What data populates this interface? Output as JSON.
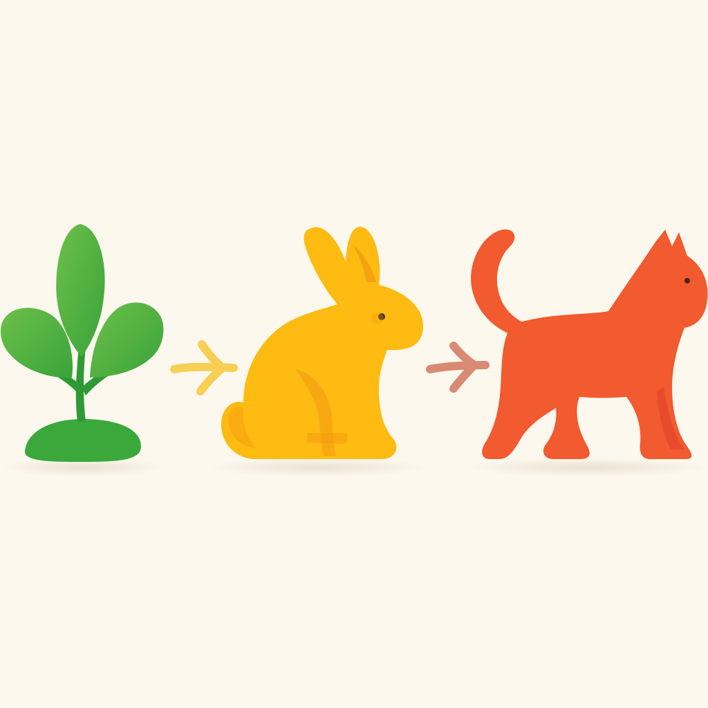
{
  "diagram": {
    "kind": "food-chain",
    "background_color": "#fdf8ee",
    "nodes": [
      {
        "id": "plant",
        "role": "producer",
        "icon": "sprout-icon",
        "color": "#4caf3a",
        "base_color": "#3aa83a"
      },
      {
        "id": "rabbit",
        "role": "herbivore",
        "icon": "rabbit-icon",
        "color": "#ffbb12",
        "shade_color": "#f39a10"
      },
      {
        "id": "cat",
        "role": "predator",
        "icon": "cat-icon",
        "color": "#f25a2f",
        "shade_color": "#e4452a"
      }
    ],
    "arrows": [
      {
        "from": "plant",
        "to": "rabbit",
        "icon": "arrow-right-icon",
        "color": "#f8cf55"
      },
      {
        "from": "rabbit",
        "to": "cat",
        "icon": "arrow-right-icon",
        "color": "#d98a72"
      }
    ]
  }
}
